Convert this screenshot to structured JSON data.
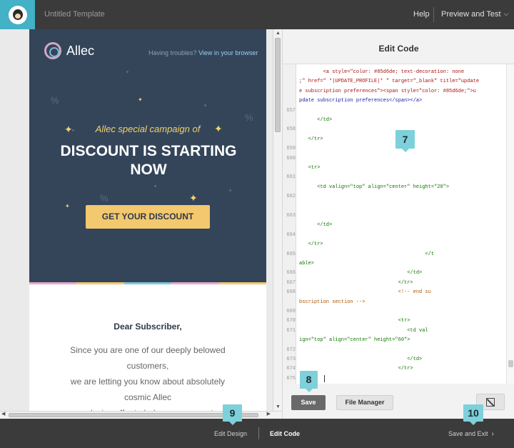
{
  "app": {
    "title": "Untitled Template",
    "help": "Help",
    "preview": "Preview and Test",
    "logo_icon": "monkey-logo-icon",
    "accent": "#43b1c6"
  },
  "email": {
    "brand": "Allec",
    "troubles_text": "Having troubles?",
    "troubles_link": "View in your browser",
    "subheading": "Allec special campaign of",
    "headline_line1": "DISCOUNT IS STARTING",
    "headline_line2": "NOW",
    "cta": "GET YOUR DISCOUNT",
    "greeting": "Dear Subscriber,",
    "p1": "Since you are one of our deeply belowed",
    "p2": "customers,",
    "p3": "we are letting you know about absolutely",
    "p4": "cosmic Allec",
    "p5": "exclusive offer to help you save up to",
    "hero_bg": "#34455a",
    "cta_color": "#f3c86e",
    "strip_colors": [
      "#e8a8c8",
      "#f3c86e",
      "#7fc6e0",
      "#e8a8c8",
      "#f3c86e"
    ]
  },
  "code_panel": {
    "title": "Edit Code",
    "save": "Save",
    "file_manager": "File Manager",
    "expand_icon": "expand-icon",
    "lines": [
      {
        "n": "",
        "t": "        <a style=\"color: #85d6de; text-decoration: none",
        "c": "str"
      },
      {
        "n": "",
        "t": ";\" href=\" *|UPDATE_PROFILE|* \" target=\"_blank\" title=\"update",
        "c": "str"
      },
      {
        "n": "",
        "t": "e subscription preferences\"><span style=\"color: #85d6de;\">u",
        "c": "str"
      },
      {
        "n": "",
        "t": "pdate subscription preferences</span></a>",
        "c": ""
      },
      {
        "n": "657",
        "t": "",
        "c": ""
      },
      {
        "n": "",
        "t": "      </td>",
        "c": "tag"
      },
      {
        "n": "658",
        "t": "",
        "c": ""
      },
      {
        "n": "",
        "t": "   </tr>",
        "c": "tag"
      },
      {
        "n": "659",
        "t": "",
        "c": ""
      },
      {
        "n": "660",
        "t": "",
        "c": ""
      },
      {
        "n": "",
        "t": "   <tr>",
        "c": "tag"
      },
      {
        "n": "661",
        "t": "",
        "c": ""
      },
      {
        "n": "",
        "t": "      <td valign=\"top\" align=\"center\" height=\"20\">",
        "c": "tag"
      },
      {
        "n": "662",
        "t": "",
        "c": ""
      },
      {
        "n": "",
        "t": "",
        "c": ""
      },
      {
        "n": "663",
        "t": "",
        "c": ""
      },
      {
        "n": "",
        "t": "      </td>",
        "c": "tag"
      },
      {
        "n": "664",
        "t": "",
        "c": ""
      },
      {
        "n": "",
        "t": "   </tr>",
        "c": "tag"
      },
      {
        "n": "665",
        "t": "                                          </t",
        "c": "tag"
      },
      {
        "n": "",
        "t": "able>",
        "c": "tag"
      },
      {
        "n": "666",
        "t": "                                    </td>",
        "c": "tag"
      },
      {
        "n": "667",
        "t": "                                 </tr>",
        "c": "tag"
      },
      {
        "n": "668",
        "t": "                                 <!-- end su",
        "c": "cmt"
      },
      {
        "n": "",
        "t": "bscription section -->",
        "c": "cmt"
      },
      {
        "n": "669",
        "t": "",
        "c": ""
      },
      {
        "n": "670",
        "t": "                                 <tr>",
        "c": "tag"
      },
      {
        "n": "671",
        "t": "                                    <td val",
        "c": "tag"
      },
      {
        "n": "",
        "t": "ign=\"top\" align=\"center\" height=\"60\">",
        "c": "tag"
      },
      {
        "n": "672",
        "t": "",
        "c": ""
      },
      {
        "n": "673",
        "t": "                                    </td>",
        "c": "tag"
      },
      {
        "n": "674",
        "t": "                                 </tr>",
        "c": "tag"
      },
      {
        "n": "675",
        "t": "",
        "c": ""
      }
    ]
  },
  "bottom": {
    "edit_design": "Edit Design",
    "edit_code": "Edit Code",
    "save_exit": "Save and Exit"
  },
  "callouts": [
    "7",
    "8",
    "9",
    "10"
  ]
}
